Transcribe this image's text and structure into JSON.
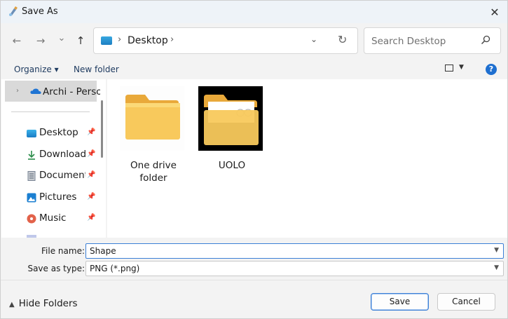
{
  "window": {
    "title": "Save As"
  },
  "navigation": {
    "back": "←",
    "forward": "→",
    "recent": "⌄",
    "up": "↑"
  },
  "address": {
    "path": "Desktop",
    "separator": "›"
  },
  "search": {
    "placeholder": "Search Desktop"
  },
  "toolbar": {
    "organize": "Organize ▾",
    "new_folder": "New folder",
    "help": "?"
  },
  "sidebar": {
    "selected": "Archi - Person",
    "items": [
      {
        "label": "Desktop",
        "icon": "desktop-icon"
      },
      {
        "label": "Downloads",
        "icon": "download-icon"
      },
      {
        "label": "Documents",
        "icon": "documents-icon"
      },
      {
        "label": "Pictures",
        "icon": "pictures-icon"
      },
      {
        "label": "Music",
        "icon": "music-icon"
      }
    ]
  },
  "files": [
    {
      "name": "One drive folder",
      "icon": "folder-icon"
    },
    {
      "name": "UOLO",
      "icon": "folder-with-files-icon"
    }
  ],
  "form": {
    "file_name_label": "File name:",
    "file_name_value": "Shape",
    "save_type_label": "Save as type:",
    "save_type_value": "PNG (*.png)"
  },
  "footer": {
    "hide_folders": "Hide Folders",
    "save": "Save",
    "cancel": "Cancel"
  },
  "colors": {
    "accent": "#3b7fd6",
    "folder": "#f8c95c",
    "titlebar": "#eef3f8"
  }
}
